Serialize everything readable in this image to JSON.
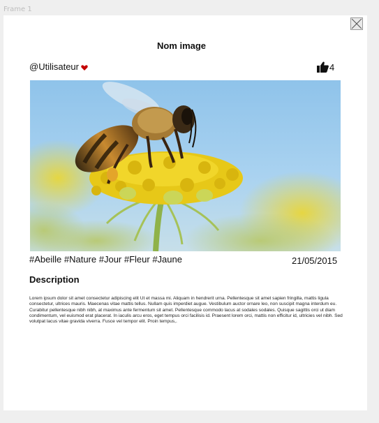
{
  "canvas": {
    "frame_label": "Frame 1"
  },
  "card": {
    "title": "Nom image",
    "username": "@Utilisateur",
    "likes_count": "4",
    "tags": "#Abeille #Nature #Jour #Fleur #Jaune",
    "date": "21/05/2015",
    "description_heading": "Description",
    "description_text": "Lorem ipsum dolor sit amet consectetur adipiscing elit Ut et massa mi. Aliquam in hendrerit urna. Pellentesque sit amet sapien fringilla, mattis ligula consectetur, ultrices mauris. Maecenas vitae mattis tellus. Nullam quis imperdiet augue. Vestibulum auctor ornare leo, non suscipit magna interdum eu. Curabitur pellentesque nibh nibh, at maximus ante fermentum sit amet. Pellentesque commodo lacus at sodales sodales. Quisque sagittis orci ut diam condimentum, vel euismod erat placerat. In iaculis arcu eros, eget tempus orci facilisis id. Praesent lorem orci, mattis non efficitur id, ultricies vel nibh. Sed volutpat lacus vitae gravida viverra. Fusce vel tempor elit. Proin tempus,."
  },
  "icons": {
    "close": "close-icon",
    "heart": "heart-icon",
    "like": "thumbs-up-icon"
  },
  "colors": {
    "background": "#efefef",
    "card": "#ffffff",
    "heart": "#c40000",
    "text": "#111111"
  }
}
